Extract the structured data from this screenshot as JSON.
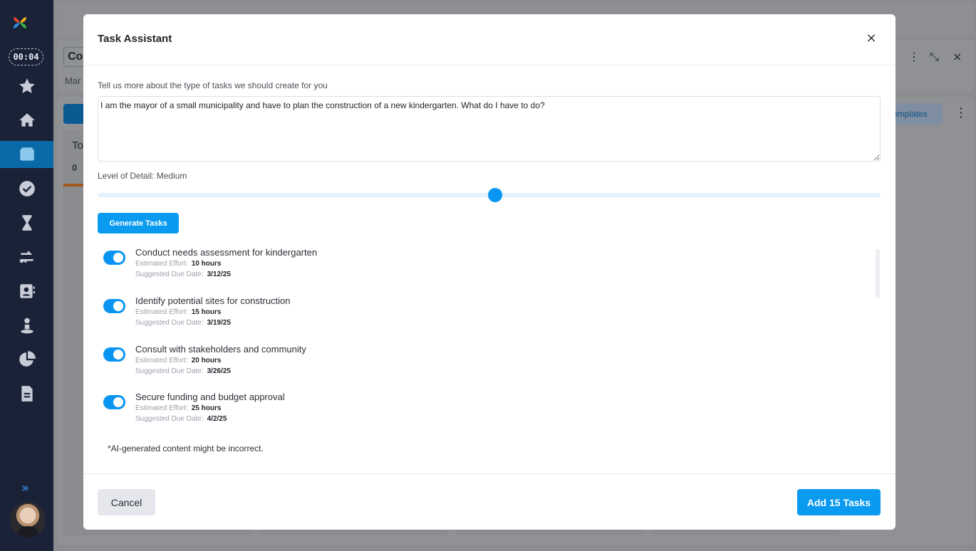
{
  "sidebar": {
    "timer": "00:04",
    "expand_glyph": "»",
    "items": [
      {
        "icon": "star-icon"
      },
      {
        "icon": "home-icon"
      },
      {
        "icon": "folder-icon",
        "active": true
      },
      {
        "icon": "check-circle-icon"
      },
      {
        "icon": "hourglass-icon"
      },
      {
        "icon": "transfer-icon"
      },
      {
        "icon": "contacts-icon"
      },
      {
        "icon": "person-pin-icon"
      },
      {
        "icon": "pie-chart-icon"
      },
      {
        "icon": "document-icon"
      }
    ]
  },
  "background": {
    "title": "Co",
    "subtitle": "Mar",
    "templates_label": "emplates",
    "column_title": "To",
    "column_count": "0"
  },
  "modal": {
    "title": "Task Assistant",
    "close_glyph": "×",
    "prompt_label": "Tell us more about the type of tasks we should create for you",
    "prompt_value": "I am the mayor of a small municipality and have to plan the construction of a new kindergarten. What do I have to do?",
    "detail_label": "Level of Detail: Medium",
    "detail_level": 0.508,
    "generate_label": "Generate Tasks",
    "effort_label": "Estimated Effort:",
    "due_label": "Suggested Due Date:",
    "tasks": [
      {
        "title": "Conduct needs assessment for kindergarten",
        "effort": "10 hours",
        "due": "3/12/25",
        "enabled": true
      },
      {
        "title": "Identify potential sites for construction",
        "effort": "15 hours",
        "due": "3/19/25",
        "enabled": true
      },
      {
        "title": "Consult with stakeholders and community",
        "effort": "20 hours",
        "due": "3/26/25",
        "enabled": true
      },
      {
        "title": "Secure funding and budget approval",
        "effort": "25 hours",
        "due": "4/2/25",
        "enabled": true
      }
    ],
    "disclaimer": "*AI-generated content might be incorrect.",
    "cancel_label": "Cancel",
    "add_label": "Add 15 Tasks"
  },
  "colors": {
    "sidebar_bg": "#1a2238",
    "accent": "#0a9bf0",
    "active_nav": "#0a6aa8"
  }
}
